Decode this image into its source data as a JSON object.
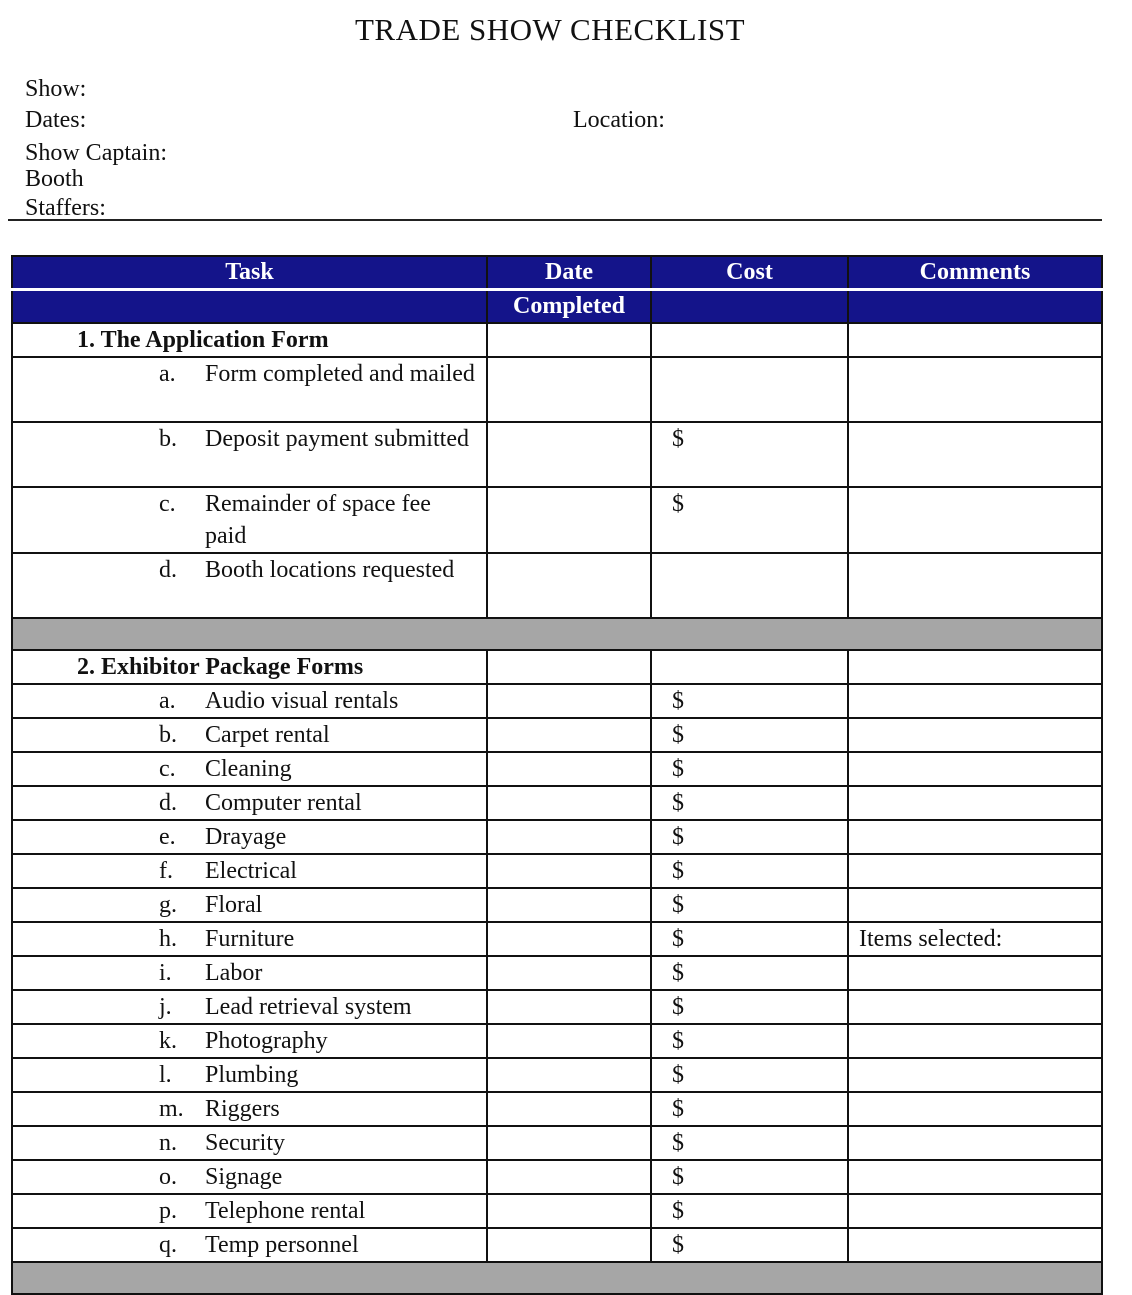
{
  "title": "TRADE SHOW CHECKLIST",
  "fields": {
    "show": "Show:",
    "dates": "Dates:",
    "location": "Location:",
    "captain": "Show Captain:",
    "booth": "Booth",
    "staffers": "Staffers:"
  },
  "colors": {
    "header_bg": "#14148a",
    "separator": "#a6a6a6"
  },
  "table": {
    "headers": [
      "Task",
      "Date",
      "Cost",
      "Comments"
    ],
    "headers2": [
      "",
      "Completed",
      "",
      ""
    ],
    "sections": [
      {
        "title": "1.  The Application Form",
        "items": [
          {
            "letter": "a.",
            "task": "Form completed and mailed",
            "cost": "",
            "comment": ""
          },
          {
            "letter": "b.",
            "task": "Deposit payment submitted",
            "cost": "$",
            "comment": ""
          },
          {
            "letter": "c.",
            "task": "Remainder of space fee paid",
            "cost": "$",
            "comment": ""
          },
          {
            "letter": "d.",
            "task": "Booth locations requested",
            "cost": "",
            "comment": ""
          }
        ]
      },
      {
        "title": "2.  Exhibitor Package Forms",
        "items": [
          {
            "letter": "a.",
            "task": "Audio visual rentals",
            "cost": "$",
            "comment": ""
          },
          {
            "letter": "b.",
            "task": "Carpet rental",
            "cost": "$",
            "comment": ""
          },
          {
            "letter": "c.",
            "task": "Cleaning",
            "cost": "$",
            "comment": ""
          },
          {
            "letter": "d.",
            "task": "Computer rental",
            "cost": "$",
            "comment": ""
          },
          {
            "letter": "e.",
            "task": "Drayage",
            "cost": "$",
            "comment": ""
          },
          {
            "letter": "f.",
            "task": "Electrical",
            "cost": "$",
            "comment": ""
          },
          {
            "letter": "g.",
            "task": "Floral",
            "cost": "$",
            "comment": ""
          },
          {
            "letter": "h.",
            "task": "Furniture",
            "cost": "$",
            "comment": "Items selected:"
          },
          {
            "letter": "i.",
            "task": "Labor",
            "cost": "$",
            "comment": ""
          },
          {
            "letter": "j.",
            "task": "Lead retrieval system",
            "cost": "$",
            "comment": ""
          },
          {
            "letter": "k.",
            "task": "Photography",
            "cost": "$",
            "comment": ""
          },
          {
            "letter": "l.",
            "task": "Plumbing",
            "cost": "$",
            "comment": ""
          },
          {
            "letter": "m.",
            "task": "Riggers",
            "cost": "$",
            "comment": ""
          },
          {
            "letter": "n.",
            "task": "Security",
            "cost": "$",
            "comment": ""
          },
          {
            "letter": "o.",
            "task": "Signage",
            "cost": "$",
            "comment": ""
          },
          {
            "letter": "p.",
            "task": "Telephone rental",
            "cost": "$",
            "comment": ""
          },
          {
            "letter": "q.",
            "task": "Temp personnel",
            "cost": "$",
            "comment": ""
          }
        ]
      }
    ]
  }
}
